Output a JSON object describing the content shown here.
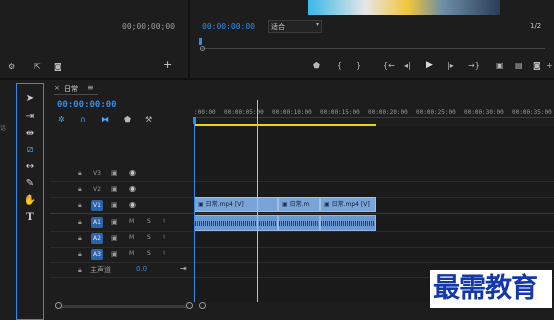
{
  "source_panel": {
    "timecode": "00;00;00;00"
  },
  "program_panel": {
    "timecode": "00:00:00:00",
    "fit_label": "适合",
    "resolution": "1/2"
  },
  "timeline": {
    "tab_label": "日常",
    "timecode": "00:00:00:00",
    "ruler_ticks": [
      ":00:00",
      "00:00:05:00",
      "00:00:10:00",
      "00:00:15:00",
      "00:00:20:00",
      "00:00:25:00",
      "00:00:30:00",
      "00:00:35:00"
    ],
    "video_tracks": [
      {
        "name": "V3",
        "active": false
      },
      {
        "name": "V2",
        "active": false
      },
      {
        "name": "V1",
        "active": true
      }
    ],
    "audio_tracks": [
      {
        "name": "A1",
        "mute": "M",
        "solo": "S"
      },
      {
        "name": "A2",
        "mute": "M",
        "solo": "S"
      },
      {
        "name": "A3",
        "mute": "M",
        "solo": "S"
      }
    ],
    "master_track": {
      "label": "主声道",
      "value": "0.0"
    },
    "video_clips": [
      "日常.mp4 [V]",
      "日常.m",
      "日常.mp4 [V]"
    ]
  },
  "watermark": "最需教育",
  "icons": {
    "tools": [
      "selection-arrow-icon",
      "track-select-icon",
      "ripple-edit-icon",
      "razor-icon",
      "slip-icon",
      "pen-icon",
      "hand-icon",
      "type-icon"
    ],
    "transport": [
      "marker-icon",
      "in-point-icon",
      "out-point-icon",
      "go-to-in-icon",
      "step-back-icon",
      "play-icon",
      "step-forward-icon",
      "go-to-out-icon",
      "insert-icon",
      "lift-icon",
      "export-frame-icon",
      "button-editor-icon"
    ]
  },
  "colors": {
    "accent": "#2d8ceb",
    "clip": "#7aa3d8",
    "work_area": "#e8d21a"
  }
}
